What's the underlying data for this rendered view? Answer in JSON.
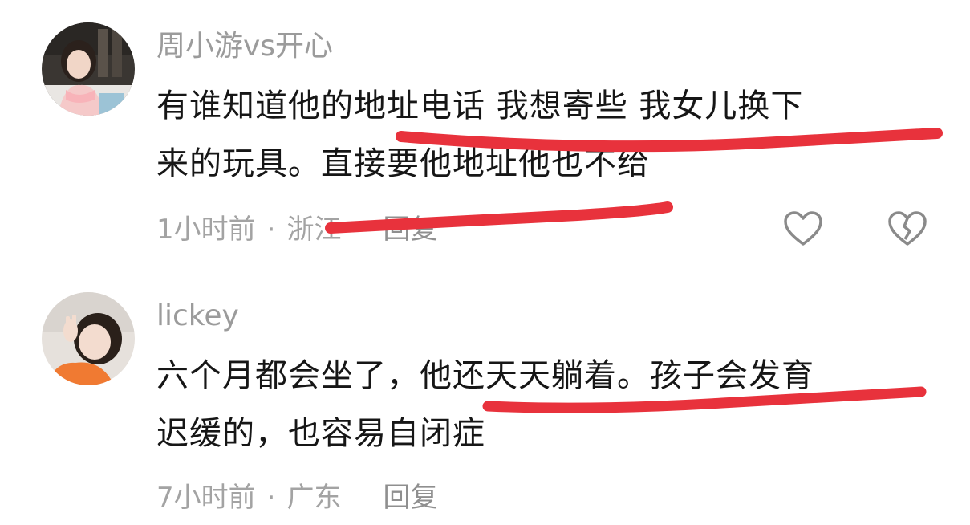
{
  "comments": [
    {
      "username": "周小游vs开心",
      "line1": "有谁知道他的地址电话 我想寄些 我女儿换下",
      "line2": "来的玩具。直接要他地址他也不给",
      "time": "1小时前",
      "separator": "·",
      "location": "浙江",
      "reply_label": "回复",
      "like_icon": "heart-outline-icon",
      "dislike_icon": "broken-heart-icon"
    },
    {
      "username": "lickey",
      "line1": "六个月都会坐了，他还天天躺着。孩子会发育",
      "line2": "迟缓的，也容易自闭症",
      "time": "7小时前",
      "separator": "·",
      "location": "广东",
      "reply_label": "回复"
    }
  ],
  "colors": {
    "highlight_stroke": "#e8323c",
    "meta_text": "#a3a3a3",
    "username_text": "#9b9b9b"
  }
}
